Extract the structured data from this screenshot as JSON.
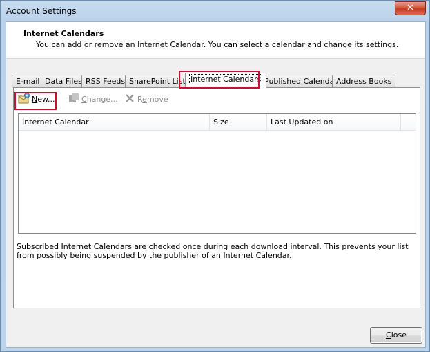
{
  "window": {
    "title": "Account Settings",
    "close_glyph": "✕"
  },
  "header": {
    "title": "Internet Calendars",
    "description": "You can add or remove an Internet Calendar. You can select a calendar and change its settings."
  },
  "tabs": [
    {
      "label": "E-mail"
    },
    {
      "label": "Data Files"
    },
    {
      "label": "RSS Feeds"
    },
    {
      "label": "SharePoint Lists"
    },
    {
      "label": "Internet Calendars"
    },
    {
      "label": "Published Calendars"
    },
    {
      "label": "Address Books"
    }
  ],
  "active_tab": "Internet Calendars",
  "toolbar": {
    "new_access": "N",
    "new_rest": "ew...",
    "change_access": "C",
    "change_rest": "hange...",
    "remove_pre": "R",
    "remove_access": "e",
    "remove_rest": "move"
  },
  "list": {
    "columns": [
      "Internet Calendar",
      "Size",
      "Last Updated on"
    ],
    "rows": []
  },
  "note": "Subscribed Internet Calendars are checked once during each download interval. This prevents your list from possibly being suspended by the publisher of an Internet Calendar.",
  "footer": {
    "close_access": "C",
    "close_rest": "lose"
  },
  "icons": {
    "new": "new-calendar-icon",
    "change": "change-icon",
    "remove": "remove-icon"
  },
  "colors": {
    "highlight": "#c8102e",
    "title_bar": "#bcd3ec"
  }
}
